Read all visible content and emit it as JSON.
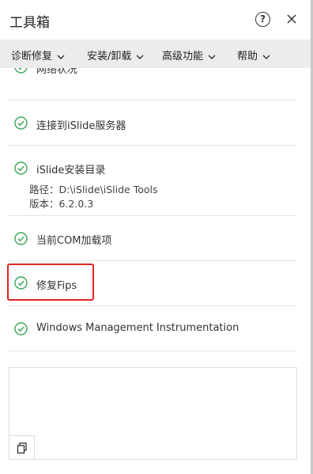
{
  "window": {
    "title": "工具箱",
    "help_label": "?",
    "help_icon": "question-circle-icon",
    "close_icon": "close-icon"
  },
  "menu": {
    "items": [
      {
        "label": "诊断修复"
      },
      {
        "label": "安装/卸载"
      },
      {
        "label": "高级功能"
      },
      {
        "label": "帮助"
      }
    ],
    "chevron_icon": "chevron-down-icon"
  },
  "checks": {
    "status_icon": "check-circle-icon",
    "status_color": "#3aa655",
    "items": [
      {
        "label": "网络状况"
      },
      {
        "label": "连接到iSlide服务器"
      },
      {
        "label": "iSlide安装目录",
        "details": [
          "路径：D:\\iSlide\\iSlide Tools",
          "版本：6.2.0.3"
        ]
      },
      {
        "label": "当前COM加载项"
      },
      {
        "label": "修复Fips"
      },
      {
        "label": "Windows Management Instrumentation"
      }
    ]
  },
  "highlight_color": "#e02424",
  "output": {
    "copy_icon": "copy-icon"
  }
}
